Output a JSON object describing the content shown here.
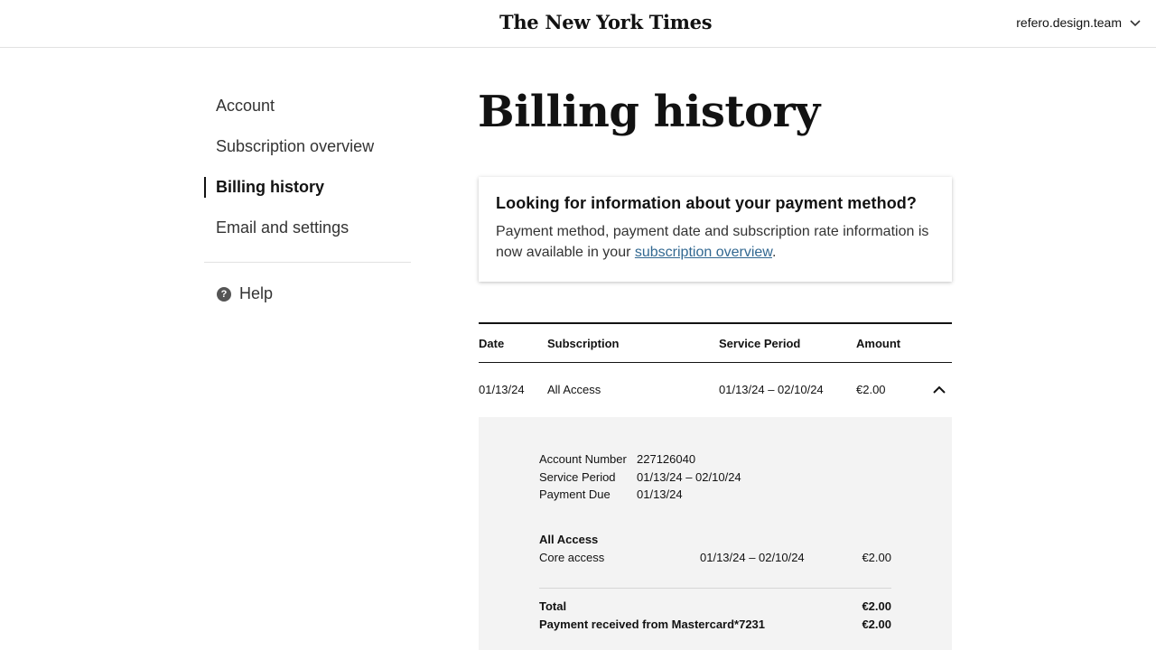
{
  "header": {
    "logo_text": "The New York Times",
    "user_name": "refero.design.team"
  },
  "sidebar": {
    "items": [
      {
        "label": "Account"
      },
      {
        "label": "Subscription overview"
      },
      {
        "label": "Billing history"
      },
      {
        "label": "Email and settings"
      }
    ],
    "help_label": "Help"
  },
  "main": {
    "title": "Billing history",
    "info_card": {
      "title": "Looking for information about your payment method?",
      "body": "Payment method, payment date and subscription rate information is now available in your ",
      "link": "subscription overview",
      "suffix": "."
    },
    "table": {
      "headers": [
        "Date",
        "Subscription",
        "Service Period",
        "Amount"
      ],
      "rows": [
        {
          "date": "01/13/24",
          "subscription": "All Access",
          "service_period": "01/13/24 – 02/10/24",
          "amount": "€2.00"
        }
      ]
    },
    "details": {
      "account_number_label": "Account Number",
      "account_number": "227126040",
      "service_period_label": "Service Period",
      "service_period": "01/13/24 – 02/10/24",
      "payment_due_label": "Payment Due",
      "payment_due": "01/13/24",
      "item_title": "All Access",
      "item_name": "Core access",
      "item_period": "01/13/24 – 02/10/24",
      "item_amount": "€2.00",
      "total_label": "Total",
      "total_amount": "€2.00",
      "payment_label": "Payment received from Mastercard*7231",
      "payment_amount": "€2.00"
    }
  }
}
